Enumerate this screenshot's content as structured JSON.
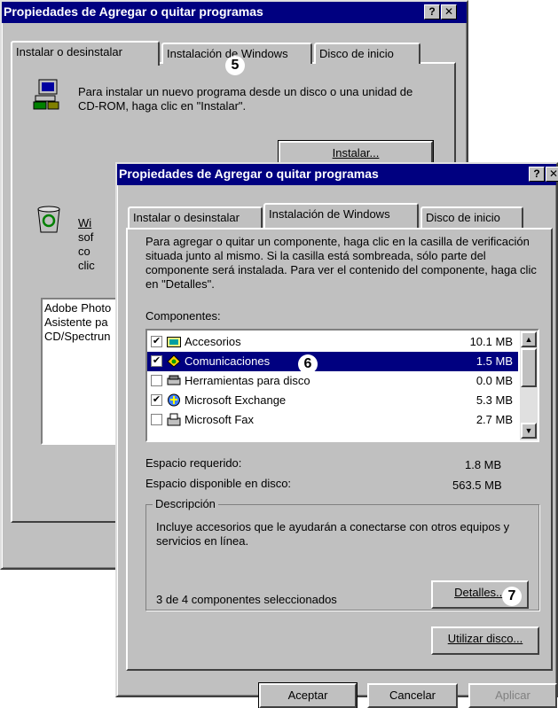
{
  "back_dialog": {
    "title": "Propiedades de Agregar o quitar programas",
    "title_buttons": [
      "?",
      "✕"
    ],
    "tabs": [
      "Instalar o desinstalar",
      "Instalación de Windows",
      "Disco de inicio"
    ],
    "install_text": "Para instalar un nuevo programa desde un disco o una unidad de CD-ROM, haga clic en \"Instalar\".",
    "install_button": "Instalar...",
    "uninstall_partial_lines": [
      "Wi",
      "sof",
      "co",
      "clic"
    ],
    "program_list_partial": [
      "Adobe Photo",
      "Asistente pa",
      "CD/Spectrun"
    ]
  },
  "front_dialog": {
    "title": "Propiedades de Agregar o quitar programas",
    "title_buttons": [
      "?",
      "✕"
    ],
    "tabs": [
      "Instalar o desinstalar",
      "Instalación de Windows",
      "Disco de inicio"
    ],
    "intro_text": "Para agregar o quitar un componente, haga clic en la casilla de verificación situada junto al mismo. Si la casilla está sombreada, sólo parte del componente será instalada. Para ver el contenido del componente, haga clic en \"Detalles\".",
    "components_label": "Componentes:",
    "components": [
      {
        "name": "Accesorios",
        "size": "10.1 MB",
        "checked": true,
        "selected": false,
        "icon": "accessories-icon"
      },
      {
        "name": "Comunicaciones",
        "size": "1.5 MB",
        "checked": true,
        "selected": true,
        "icon": "communications-icon"
      },
      {
        "name": "Herramientas para disco",
        "size": "0.0 MB",
        "checked": false,
        "selected": false,
        "icon": "disk-tools-icon"
      },
      {
        "name": "Microsoft Exchange",
        "size": "5.3 MB",
        "checked": true,
        "selected": false,
        "icon": "exchange-icon"
      },
      {
        "name": "Microsoft Fax",
        "size": "2.7 MB",
        "checked": false,
        "selected": false,
        "icon": "fax-icon"
      }
    ],
    "space_required_label": "Espacio requerido:",
    "space_required_value": "1.8 MB",
    "space_available_label": "Espacio disponible en disco:",
    "space_available_value": "563.5 MB",
    "description_legend": "Descripción",
    "description_text": "Incluye accesorios que le ayudarán a conectarse con otros equipos y servicios en línea.",
    "selected_count": "3 de 4 componentes seleccionados",
    "details_button": "Detalles...",
    "use_disk_button": "Utilizar disco...",
    "footer_buttons": [
      "Aceptar",
      "Cancelar",
      "Aplicar"
    ]
  },
  "callouts": [
    "5",
    "6",
    "7"
  ]
}
